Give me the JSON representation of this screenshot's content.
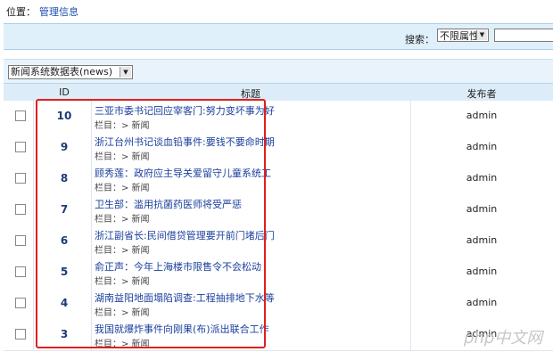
{
  "breadcrumb": {
    "label": "位置：",
    "link": "管理信息"
  },
  "search": {
    "label": "搜索：",
    "select_value": "不限属性"
  },
  "table_select": {
    "value": "新闻系统数据表(news)"
  },
  "table": {
    "headers": {
      "id": "ID",
      "title": "标题",
      "publisher": "发布者"
    },
    "rows": [
      {
        "id": "10",
        "title": "三亚市委书记回应宰客门:努力变坏事为好",
        "column": "栏目：> 新闻",
        "publisher": "admin"
      },
      {
        "id": "9",
        "title": "浙江台州书记谈血铅事件:要钱不要命时期",
        "column": "栏目：> 新闻",
        "publisher": "admin"
      },
      {
        "id": "8",
        "title": "顾秀莲：政府应主导关爱留守儿童系统工",
        "column": "栏目：> 新闻",
        "publisher": "admin"
      },
      {
        "id": "7",
        "title": "卫生部：滥用抗菌药医师将受严惩",
        "column": "栏目：> 新闻",
        "publisher": "admin"
      },
      {
        "id": "6",
        "title": "浙江副省长:民间借贷管理要开前门堵后门",
        "column": "栏目：> 新闻",
        "publisher": "admin"
      },
      {
        "id": "5",
        "title": "俞正声：今年上海楼市限售令不会松动",
        "column": "栏目：> 新闻",
        "publisher": "admin"
      },
      {
        "id": "4",
        "title": "湖南益阳地面塌陷调查:工程抽排地下水等",
        "column": "栏目：> 新闻",
        "publisher": "admin"
      },
      {
        "id": "3",
        "title": "我国就爆炸事件向刚果(布)派出联合工作",
        "column": "栏目：> 新闻",
        "publisher": "admin"
      }
    ]
  },
  "watermark": {
    "text": "php中文网"
  }
}
